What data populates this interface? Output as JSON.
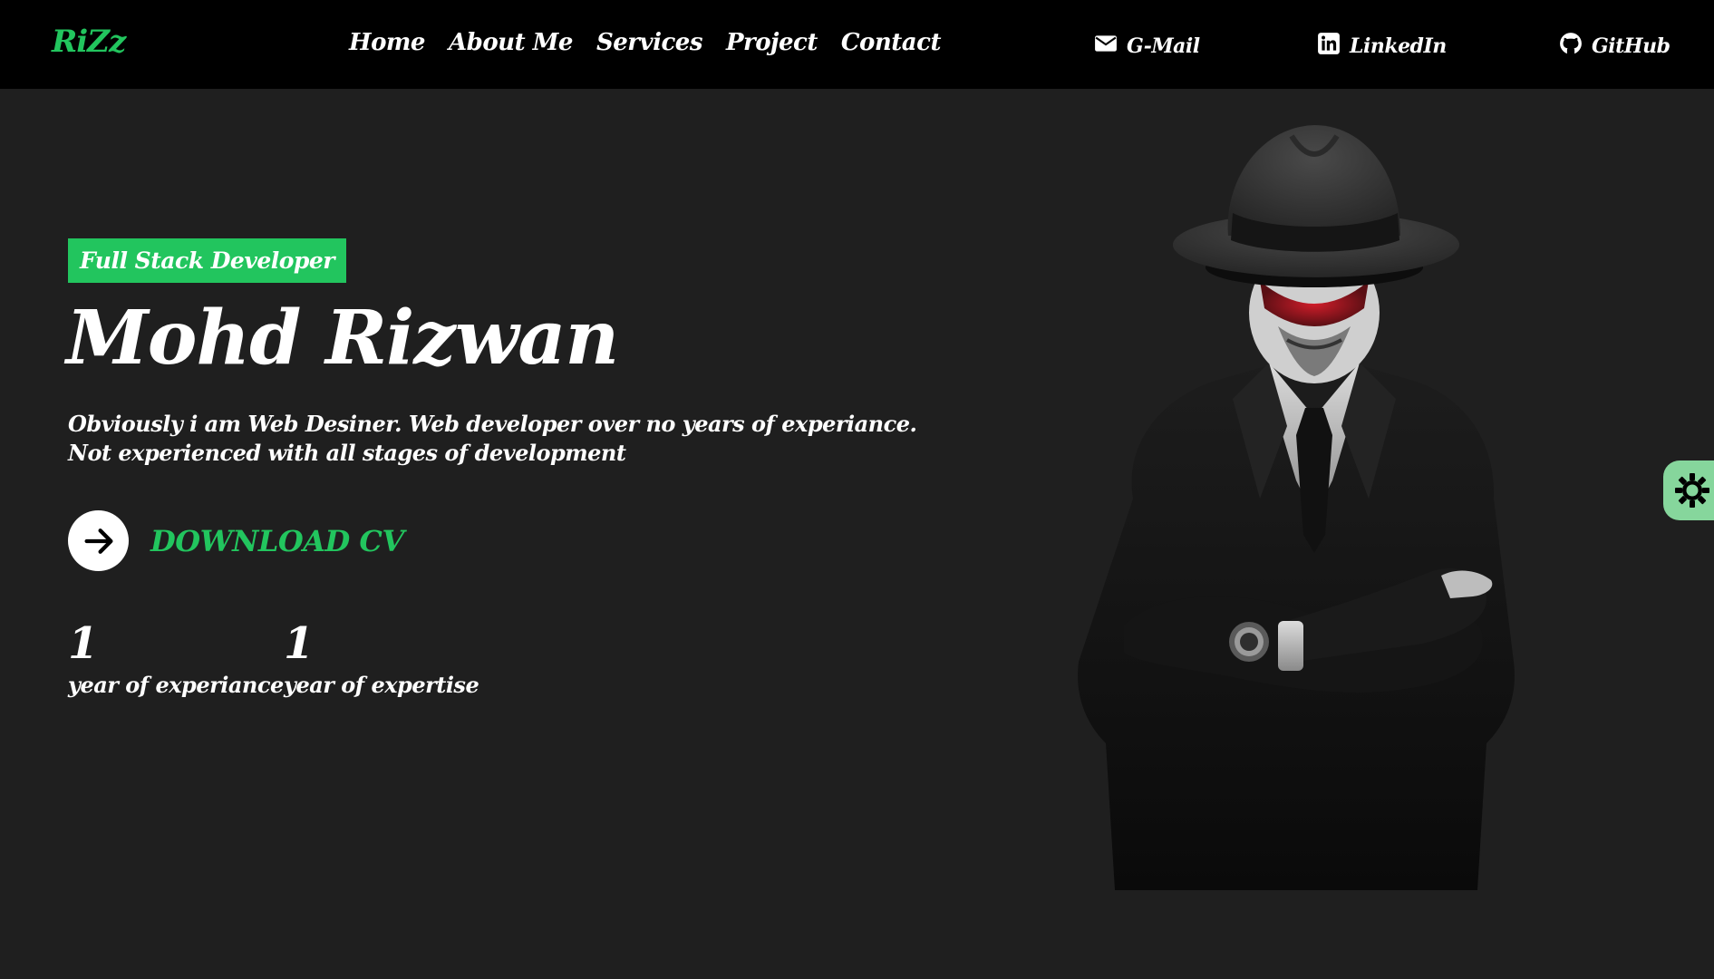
{
  "header": {
    "logo": "RiZz",
    "nav": [
      {
        "label": "Home"
      },
      {
        "label": "About Me"
      },
      {
        "label": "Services"
      },
      {
        "label": "Project"
      },
      {
        "label": "Contact"
      }
    ],
    "social": {
      "gmail": {
        "label": "G-Mail",
        "icon": "envelope-icon"
      },
      "linkedin": {
        "label": "LinkedIn",
        "icon": "linkedin-icon"
      },
      "github": {
        "label": "GitHub",
        "icon": "github-icon"
      }
    }
  },
  "hero": {
    "role": "Full Stack Developer",
    "name": "Mohd Rizwan",
    "description": "Obviously i am Web Desiner. Web developer over no years of experiance. Not experienced with all stages of development",
    "cta": {
      "label": "DOWNLOAD CV",
      "icon": "arrow-right-icon"
    },
    "stats": [
      {
        "value": "1",
        "label": "year of experiance"
      },
      {
        "value": "1",
        "label": "year of expertise"
      }
    ],
    "image": {
      "icon": "hooded-figure-portrait"
    }
  },
  "theme_toggle": {
    "icon": "sun-icon"
  },
  "colors": {
    "accent": "#22c55e",
    "background": "#1f1f1f",
    "header": "#000000",
    "toggle": "#86d69c"
  }
}
